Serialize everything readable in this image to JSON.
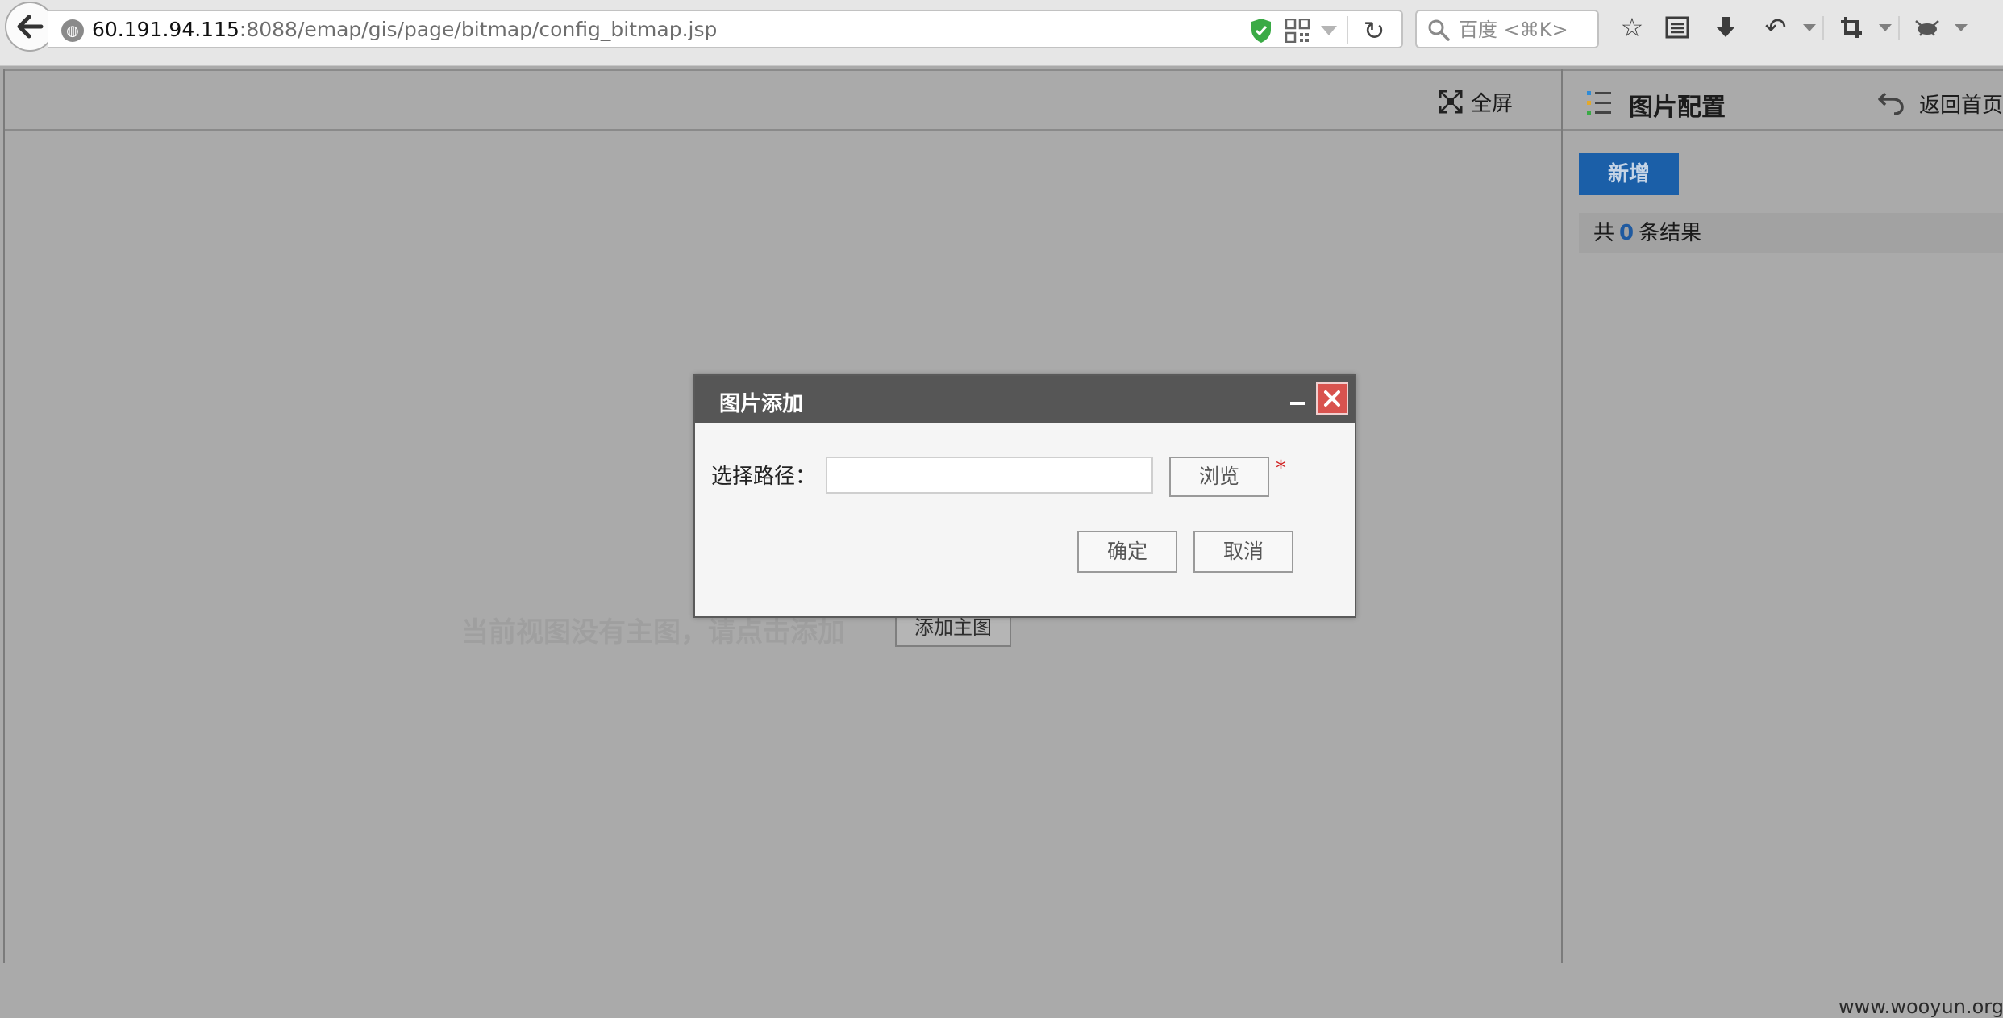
{
  "browser": {
    "url_host": "60.191.94.115",
    "url_path": ":8088/emap/gis/page/bitmap/config_bitmap.jsp",
    "search_placeholder": "百度 <⌘K>"
  },
  "toolbar": {
    "fullscreen_label": "全屏"
  },
  "main": {
    "empty_message": "当前视图没有主图，请点击添加",
    "add_main_label": "添加主图"
  },
  "side_panel": {
    "title": "图片配置",
    "back_home_label": "返回首页",
    "add_label": "新增",
    "result_prefix": "共",
    "result_count": "0",
    "result_suffix": "条结果"
  },
  "dialog": {
    "title": "图片添加",
    "path_label": "选择路径：",
    "path_value": "",
    "browse_label": "浏览",
    "required_mark": "*",
    "ok_label": "确定",
    "cancel_label": "取消"
  },
  "watermark": "www.wooyun.org",
  "colors": {
    "primary_button": "#1b5fa8",
    "close_button": "#d9534f",
    "dialog_header": "#565656",
    "overlay_gray": "#aaaaaa"
  }
}
